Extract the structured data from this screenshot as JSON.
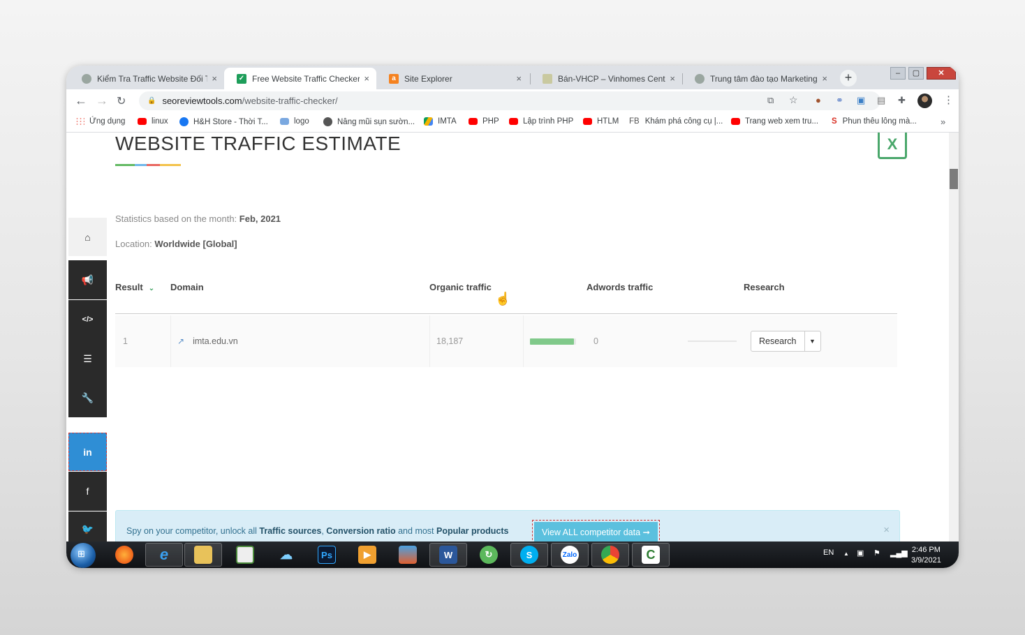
{
  "browser": {
    "tabs": [
      {
        "title": "Kiểm Tra Traffic Website Đối Th",
        "favicon_color": "#9aa6a0"
      },
      {
        "title": "Free Website Traffic Checker - T",
        "favicon_color": "#1e9e5a"
      },
      {
        "title": "Site Explorer",
        "favicon_color": "#f58220"
      },
      {
        "title": "Bán-VHCP – Vinhomes Central",
        "favicon_color": "#c9c9a0"
      },
      {
        "title": "Trung tâm đào tạo Marketing C",
        "favicon_color": "#9aa6a0"
      }
    ],
    "new_tab_label": "+",
    "close_glyph": "×",
    "url_domain": "seoreviewtools.com",
    "url_path": "/website-traffic-checker/",
    "bookmarks": [
      {
        "label": "Ứng dụng",
        "icon": "apps"
      },
      {
        "label": "linux",
        "icon": "yt"
      },
      {
        "label": "H&H Store - Thời T...",
        "icon": "fb"
      },
      {
        "label": "logo",
        "icon": "gl"
      },
      {
        "label": "Nâng mũi sụn sườn...",
        "icon": "gr"
      },
      {
        "label": "IMTA",
        "icon": "dr"
      },
      {
        "label": "PHP",
        "icon": "yt"
      },
      {
        "label": "Lập trình PHP",
        "icon": "yt"
      },
      {
        "label": "HTLM",
        "icon": "yt"
      },
      {
        "label": "Khám phá công cụ |...",
        "icon": "fbtext",
        "prefix": "FB"
      },
      {
        "label": "Trang web xem tru...",
        "icon": "yt"
      },
      {
        "label": "Phun thêu lông mà...",
        "icon": "s",
        "prefix": "S"
      }
    ],
    "more_bookmarks": "»"
  },
  "page": {
    "title": "WEBSITE TRAFFIC ESTIMATE",
    "stats_label": "Statistics based on the month:",
    "stats_value": "Feb, 2021",
    "location_label": "Location:",
    "location_value": "Worldwide [Global]",
    "excel_label": "X",
    "table": {
      "headers": [
        "Result",
        "Domain",
        "Organic traffic",
        "Adwords traffic",
        "Research"
      ],
      "rows": [
        {
          "rank": "1",
          "domain": "imta.edu.vn",
          "organic": "18,187",
          "organic_fill": 0.95,
          "adwords": "0",
          "adwords_fill": 0,
          "research_label": "Research"
        }
      ]
    },
    "alert": {
      "t1": "Spy on your competitor, unlock all",
      "b1": "Traffic sources",
      "t2": ",",
      "b2": "Conversion ratio",
      "t3": "and most",
      "b3": "Popular products",
      "button": "View ALL competitor data ➞",
      "close": "×"
    },
    "sidebar_icons": [
      "home-icon",
      "megaphone-icon",
      "code-icon",
      "list-icon",
      "wrench-icon",
      "linkedin-icon",
      "facebook-icon",
      "twitter-icon"
    ],
    "sidebar_labels": {
      "linkedin": "in",
      "facebook": "f"
    }
  },
  "taskbar": {
    "language": "EN",
    "time": "2:46 PM",
    "date": "3/9/2021"
  }
}
